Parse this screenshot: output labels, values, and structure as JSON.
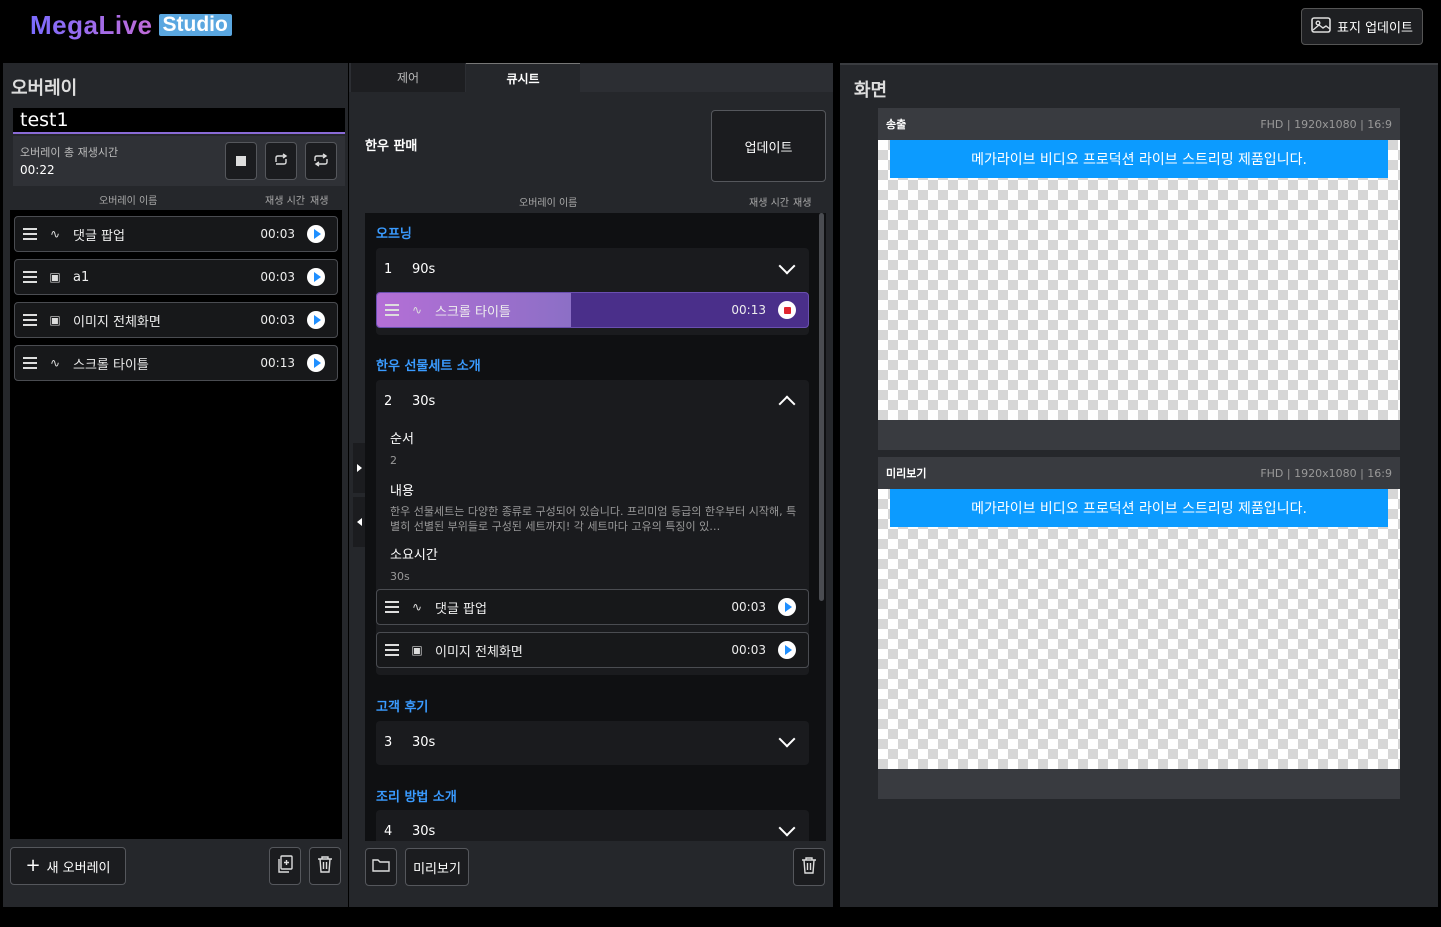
{
  "app": {
    "logo_main": "MegaLive",
    "logo_studio": "Studio",
    "cover_update_label": "표지 업데이트"
  },
  "left": {
    "title": "오버레이",
    "overlay_name": "test1",
    "total_time_label": "오버레이 총 재생시간",
    "total_time": "00:22",
    "col_name": "오버레이 이름",
    "col_time": "재생 시간",
    "col_play": "재생",
    "items": [
      {
        "kind": "scroll-icon",
        "label": "댓글 팝업",
        "time": "00:03"
      },
      {
        "kind": "image-icon",
        "label": "a1",
        "time": "00:03"
      },
      {
        "kind": "image-icon",
        "label": "이미지 전체화면",
        "time": "00:03"
      },
      {
        "kind": "scroll-icon",
        "label": "스크롤 타이틀",
        "time": "00:13"
      }
    ],
    "new_overlay_label": "새 오버레이"
  },
  "center": {
    "tabs": [
      {
        "label": "제어"
      },
      {
        "label": "큐시트"
      }
    ],
    "sheet_title": "한우 판매",
    "update_label": "업데이트",
    "col_name": "오버레이 이름",
    "col_time": "재생 시간",
    "col_play": "재생",
    "sections": [
      {
        "title": "오프닝",
        "num": "1",
        "duration": "90s"
      },
      {
        "title": "한우 선물세트 소개",
        "num": "2",
        "duration": "30s"
      },
      {
        "title": "고객 후기",
        "num": "3",
        "duration": "30s"
      },
      {
        "title": "조리 방법 소개",
        "num": "4",
        "duration": "30s"
      }
    ],
    "playing_item": {
      "label": "스크롤 타이틀",
      "time": "00:13",
      "progress": 0.45
    },
    "detail": {
      "order_label": "순서",
      "order_value": "2",
      "content_label": "내용",
      "content_value": "한우 선물세트는 다양한 종류로 구성되어 있습니다. 프리미엄 등급의 한우부터 시작해, 특별히 선별된 부위들로 구성된 세트까지! 각 세트마다 고유의 특징이 있…",
      "duration_label": "소요시간",
      "duration_value": "30s"
    },
    "section2_items": [
      {
        "kind": "scroll-icon",
        "label": "댓글 팝업",
        "time": "00:03"
      },
      {
        "kind": "image-icon",
        "label": "이미지 전체화면",
        "time": "00:03"
      }
    ],
    "preview_label": "미리보기"
  },
  "right": {
    "title": "화면",
    "program": {
      "label": "송출",
      "spec": "FHD | 1920x1080 | 16:9",
      "banner": "메가라이브 비디오 프로덕션 라이브 스트리밍 제품입니다."
    },
    "preview": {
      "label": "미리보기",
      "spec": "FHD | 1920x1080 | 16:9",
      "banner": "메가라이브 비디오 프로덕션 라이브 스트리밍 제품입니다."
    }
  },
  "colors": {
    "accent": "#3a9bff",
    "banner": "#0c9bff",
    "playing": "#8a5cd0",
    "stop": "#e0262f"
  }
}
